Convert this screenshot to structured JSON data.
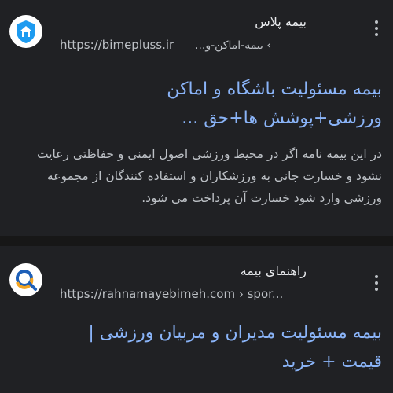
{
  "results": [
    {
      "site_name": "بیمه پلاس",
      "url": "https://bimepluss.ir",
      "breadcrumb": "› بیمه-اماکن-و...",
      "title_line1": "بیمه مسئولیت باشگاه و اماکن",
      "title_line2": "ورزشی+پوشش ها+حق ...",
      "snippet": "در این بیمه نامه اگر در محیط ورزشی اصول ایمنی و حفاظتی رعایت نشود و خسارت جانی به ورزشکاران و استفاده کنندگان از مجموعه ورزشی وارد شود خسارت آن پرداخت می شود.",
      "favicon": "house-shield-icon",
      "accent": "#1d9bf0"
    },
    {
      "site_name": "راهنمای بیمه",
      "url": "https://rahnamayebimeh.com › spor...",
      "title_line1": "بیمه مسئولیت مدیران و مربیان ورزشی |",
      "title_line2": "قیمت + خرید",
      "favicon": "search-magnifier-icon",
      "accent": "#f5a623"
    }
  ],
  "colors": {
    "background": "#202124",
    "title": "#8ab4f8",
    "text": "#bdc1c6",
    "separator": "#171717"
  }
}
